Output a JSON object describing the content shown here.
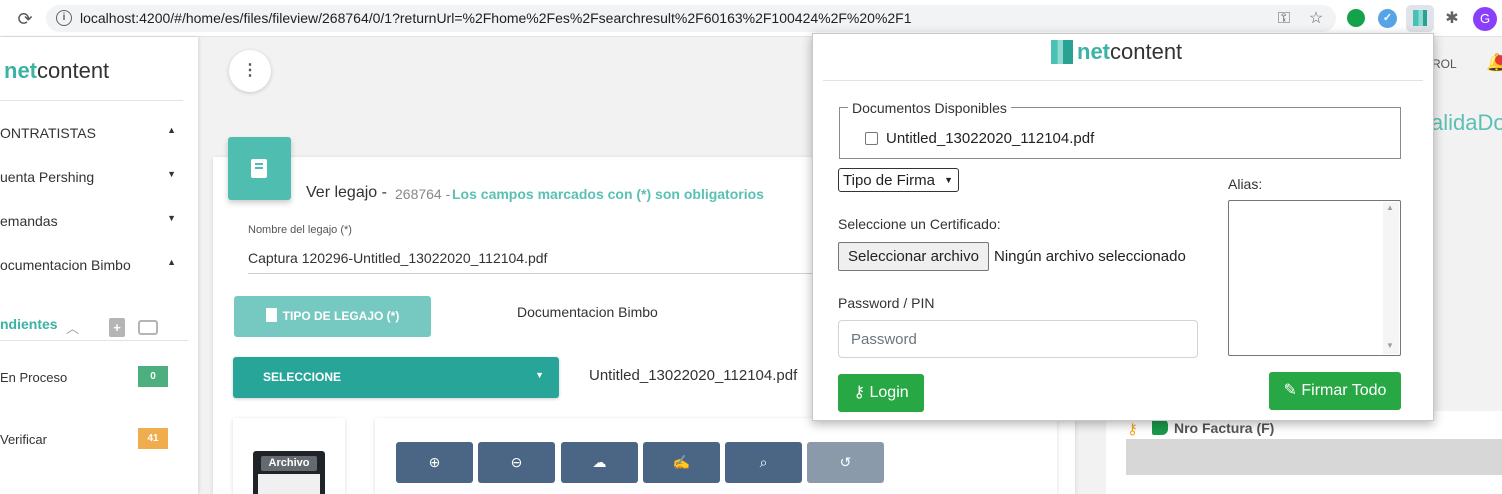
{
  "browser": {
    "url": "localhost:4200/#/home/es/files/fileview/268764/0/1?returnUrl=%2Fhome%2Fes%2Fsearchresult%2F60163%2F100424%2F%20%2F1",
    "reload_glyph": "⟳",
    "info_glyph": "i",
    "key_glyph": "⚿",
    "star_glyph": "☆",
    "ext_blue_glyph": "✓",
    "puzzle_glyph": "✱",
    "profile_initial": "G"
  },
  "sidebar": {
    "logo_net": "net",
    "logo_content": "content",
    "items": [
      {
        "label": "ONTRATISTAS",
        "caret": "▲"
      },
      {
        "label": "uenta Pershing",
        "caret": "▼"
      },
      {
        "label": "emandas",
        "caret": "▼"
      },
      {
        "label": "ocumentacion Bimbo",
        "caret": "▲"
      }
    ],
    "pending_title": "ndientes",
    "pending_chevron": "︿",
    "pending_add_glyph": "+",
    "pending_rows": [
      {
        "label": "En Proceso",
        "count": "0",
        "color": "#4caf7d"
      },
      {
        "label": "Verificar",
        "count": "41",
        "color": "#f0ad4e"
      }
    ]
  },
  "main": {
    "dots_glyph": "⋮",
    "ver_title": "Ver legajo -",
    "ver_id": "268764 -",
    "ver_note": "Los campos marcados con (*) son obligatorios",
    "nombre_label": "Nombre del legajo (*)",
    "nombre_value": "Captura 120296-Untitled_13022020_112104.pdf",
    "tipo_legajo_label": "TIPO DE LEGAJO (*)",
    "tipo_legajo_value": "Documentacion Bimbo",
    "seleccione_label": "SELECCIONE",
    "seleccione_caret": "▼",
    "file_label": "Untitled_13022020_112104.pdf",
    "archivo_label": "Archivo",
    "toolbar": [
      {
        "name": "zoom-in-button",
        "glyph": "⊕",
        "icon": "zoom-in-icon"
      },
      {
        "name": "zoom-out-button",
        "glyph": "⊖",
        "icon": "zoom-out-icon"
      },
      {
        "name": "download-button",
        "glyph": "☁",
        "icon": "cloud-download-icon"
      },
      {
        "name": "signature-button",
        "glyph": "✍",
        "icon": "signature-icon"
      },
      {
        "name": "search-button",
        "glyph": "⌕",
        "icon": "search-icon"
      },
      {
        "name": "history-button",
        "glyph": "↺",
        "icon": "history-icon"
      }
    ]
  },
  "right": {
    "rol": "ROL",
    "bell_glyph": "🔔",
    "valida_text": "alidaDo",
    "key_glyph": "⚷",
    "nro_factura": "Nro Factura (F)"
  },
  "popup": {
    "logo_net": "net",
    "logo_content": "content",
    "docs_legend": "Documentos Disponibles",
    "doc_name": "Untitled_13022020_112104.pdf",
    "tipo_firma": "Tipo de Firma",
    "tipo_firma_caret": "▼",
    "cert_label": "Seleccione un Certificado:",
    "file_button": "Seleccionar archivo",
    "file_none": "Ningún archivo seleccionado",
    "pw_label": "Password / PIN",
    "pw_placeholder": "Password",
    "login_glyph": "⚷",
    "login_label": "Login",
    "alias_label": "Alias:",
    "scroll_up": "▲",
    "scroll_down": "▼",
    "firmar_glyph": "✎",
    "firmar_label": "Firmar Todo"
  }
}
